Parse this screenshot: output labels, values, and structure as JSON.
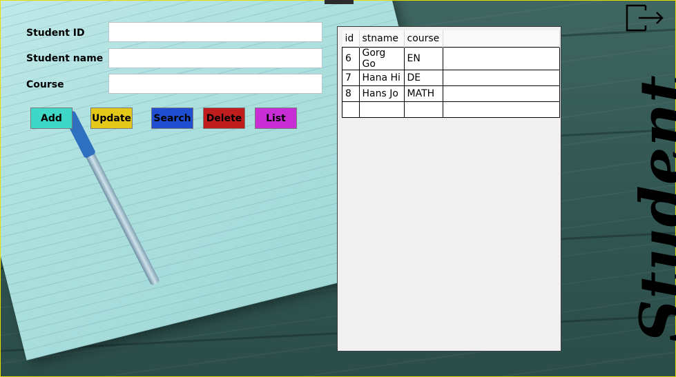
{
  "form": {
    "fields": [
      {
        "label": "Student ID",
        "value": ""
      },
      {
        "label": "Student name",
        "value": ""
      },
      {
        "label": "Course",
        "value": ""
      }
    ]
  },
  "buttons": [
    {
      "label": "Add",
      "color": "#3fd7c7"
    },
    {
      "label": "Update",
      "color": "#e3c81a"
    },
    {
      "label": "Search",
      "color": "#1f4fd0"
    },
    {
      "label": "Delete",
      "color": "#c01e1e"
    },
    {
      "label": "List",
      "color": "#c72ed6"
    }
  ],
  "grid": {
    "columns": [
      "id",
      "stname",
      "course"
    ],
    "rows": [
      [
        "6",
        "Gorg Go",
        "EN"
      ],
      [
        "7",
        "Hana Hi",
        "DE"
      ],
      [
        "8",
        "Hans Jo",
        "MATH"
      ]
    ]
  },
  "side_title": "Student",
  "icons": {
    "logout": "logout-icon"
  }
}
